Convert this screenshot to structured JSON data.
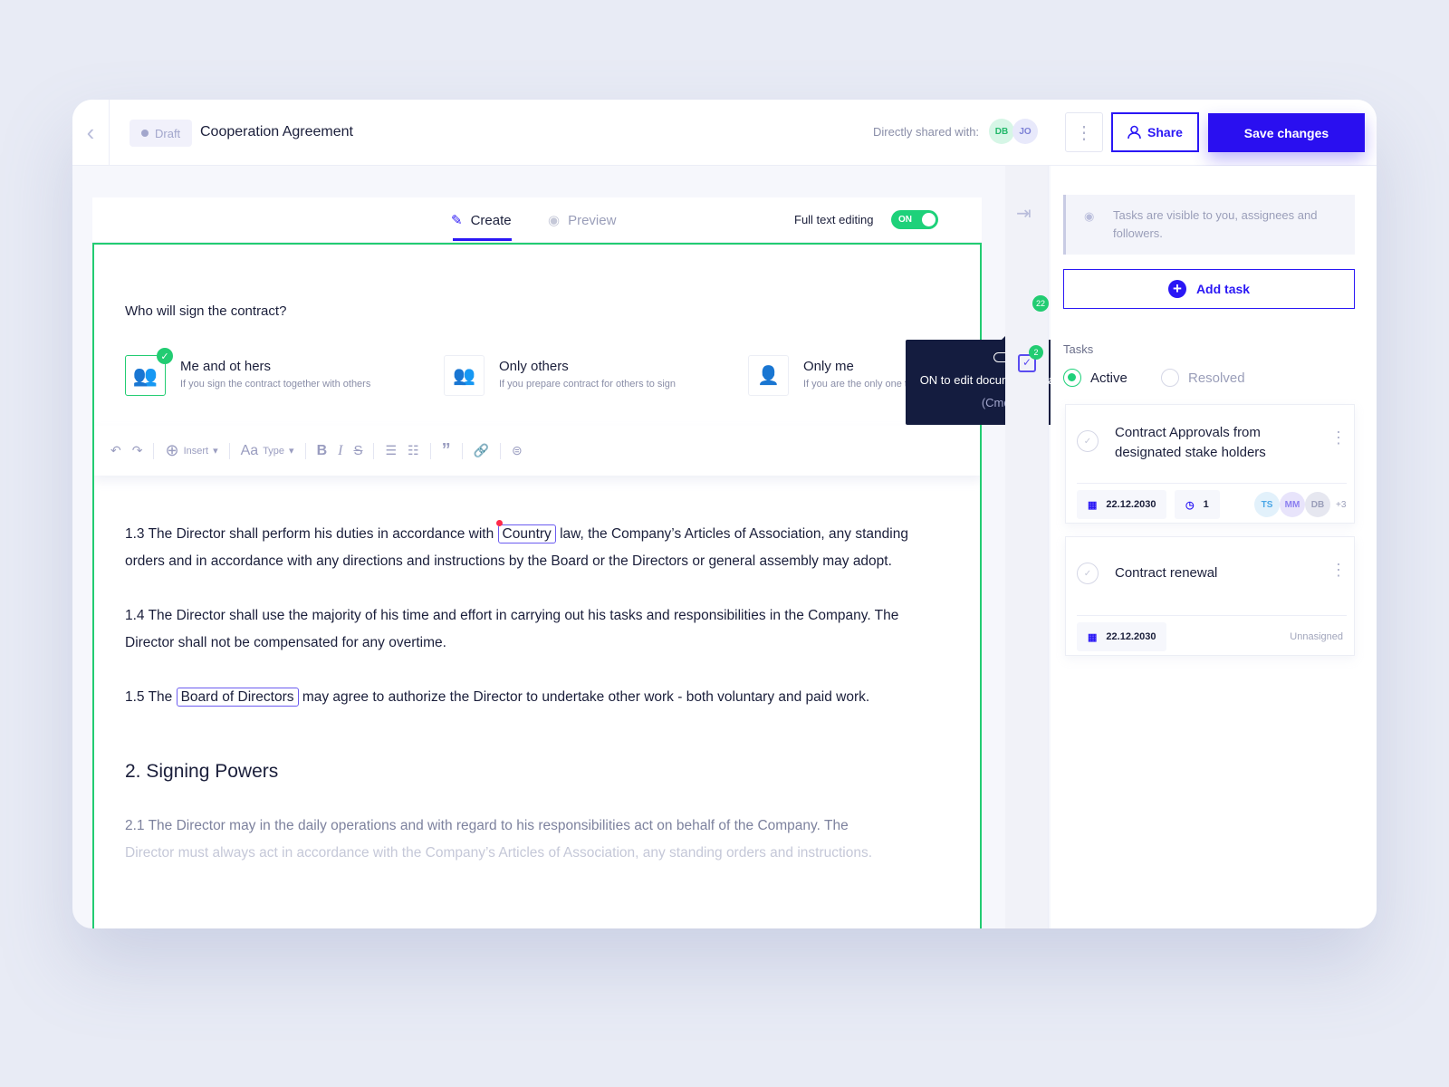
{
  "header": {
    "status": "Draft",
    "title": "Cooperation Agreement",
    "shared_label": "Directly shared with:",
    "shared_avatars": [
      "DB",
      "JO"
    ],
    "share": "Share",
    "save": "Save changes"
  },
  "editor": {
    "tabs": [
      "Create",
      "Preview"
    ],
    "full_text_label": "Full text editing",
    "toggle": "ON",
    "tooltip": {
      "text": "ON to edit document paragraphs",
      "shortcut": "(Cmd+E)"
    },
    "question": "Who will sign the contract?",
    "options": [
      {
        "title": "Me and ot hers",
        "desc": "If you sign the contract together with others",
        "selected": true
      },
      {
        "title": "Only others",
        "desc": "If you prepare contract for others to sign"
      },
      {
        "title": "Only me",
        "desc": "If you are the only one to sign"
      }
    ],
    "toolbar": {
      "insert": "Insert",
      "type_icon": "Aa",
      "type": "Type"
    },
    "doc": {
      "p13_a": "1.3 The Director shall perform his duties in accordance with ",
      "p13_tag": "Country",
      "p13_b": " law, the Company’s Articles of Association, any standing orders and in accordance with any directions and instructions by the Board or the Directors or general assembly may adopt.",
      "p14": "1.4 The Director shall use the majority of his time and effort in carrying out his tasks and responsibilities in the Company. The Director shall not be compensated for any overtime.",
      "p15_a": "1.5 The ",
      "p15_tag": "Board of Directors",
      "p15_b": " may agree to authorize the Director to undertake other work - both voluntary and paid work.",
      "h2": "2. Signing Powers",
      "p21_a": "2.1 The Director may in the daily operations and with regard to his responsibilities act on behalf of the Company. The",
      "p21_b": "Director must always act in accordance with the Company’s Articles of Association, any standing orders and instructions."
    }
  },
  "rail": {
    "badge_comments": "22",
    "badge_tasks": "2"
  },
  "sidebar": {
    "info": "Tasks are visible to you, assignees and followers.",
    "add_task": "Add task",
    "tasks_label": "Tasks",
    "filters": [
      "Active",
      "Resolved"
    ],
    "tasks": [
      {
        "title": "Contract Approvals from designated stake holders",
        "date": "22.12.2030",
        "count": "1",
        "assignees": [
          "TS",
          "MM",
          "DB"
        ],
        "more": "+3"
      },
      {
        "title": "Contract renewal",
        "date": "22.12.2030",
        "assignee": "Unnasigned"
      }
    ]
  },
  "colors": {
    "accent": "#2a0ff0",
    "success": "#1ed17a",
    "dark": "#141c3f"
  }
}
